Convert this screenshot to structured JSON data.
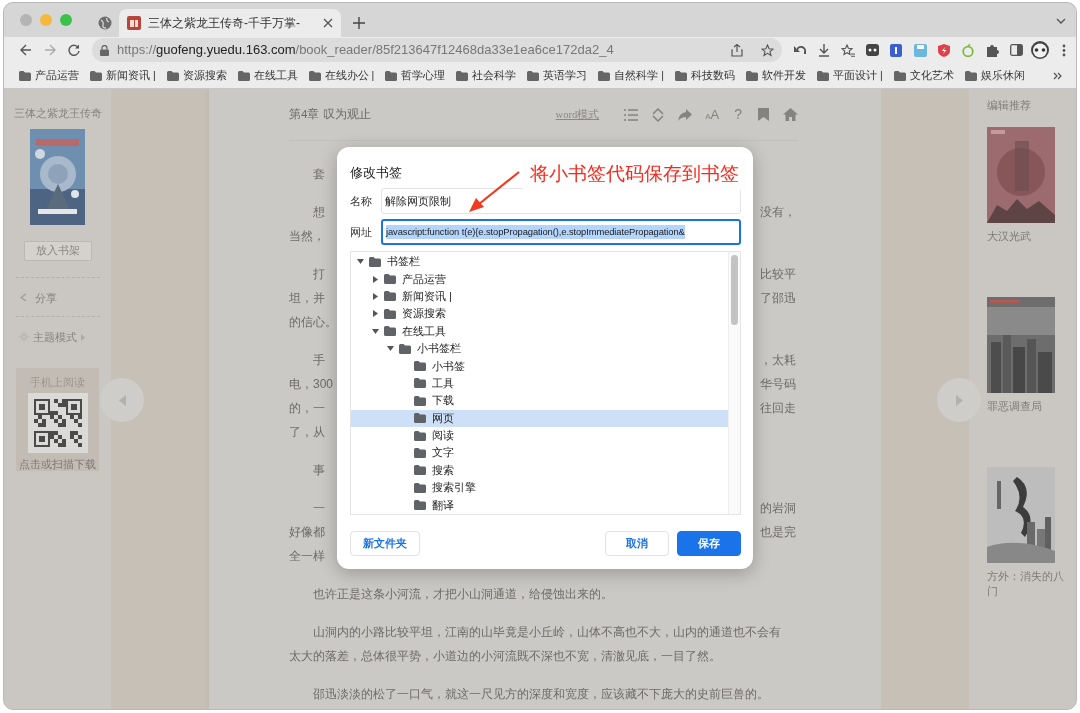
{
  "browser": {
    "tab": {
      "title": "三体之紫龙王传奇-千手万掌-"
    },
    "url": {
      "scheme": "https://",
      "host": "guofeng.yuedu.163.com",
      "path": "/book_reader/85f213647f12468da33e1ea6ce172da2_4"
    },
    "bookmarks": [
      "产品运营",
      "新闻资讯 |",
      "资源搜索",
      "在线工具",
      "在线办公 |",
      "哲学心理",
      "社会科学",
      "英语学习",
      "自然科学 |",
      "科技数码",
      "软件开发",
      "平面设计 |",
      "文化艺术",
      "娱乐休闲"
    ]
  },
  "left_panel": {
    "book_title": "三体之紫龙王传奇",
    "shelf_button": "放入书架",
    "share": "分享",
    "theme_mode": "主题模式",
    "mobile": {
      "title": "手机上阅读",
      "caption": "点击或扫描下载"
    }
  },
  "reader": {
    "chapter": "第4章 叹为观止",
    "mode_link": "word模式",
    "font_glyph": "AA",
    "help_glyph": "?",
    "paragraphs": [
      {
        "lines": [
          {
            "left": "套"
          }
        ]
      },
      {
        "lines": [
          {
            "left": "想",
            "right": "没有，"
          },
          {
            "left": "当然，"
          }
        ]
      },
      {
        "lines": [
          {
            "left": "打",
            "right": "比较平"
          },
          {
            "left": "坦，并",
            "right": "了邵迅"
          },
          {
            "left": "的信心。"
          }
        ]
      },
      {
        "lines": [
          {
            "left": "手",
            "right": "，太耗"
          },
          {
            "left": "电，300",
            "right": "华号码"
          },
          {
            "left": "的，一",
            "right": "往回走"
          },
          {
            "left": "了，从"
          }
        ]
      },
      {
        "lines": [
          {
            "left": "事"
          }
        ]
      },
      {
        "lines": [
          {
            "left": "一",
            "right": "的岩洞"
          },
          {
            "left": "好像都",
            "right": "也是完"
          },
          {
            "left": "全一样"
          }
        ]
      },
      {
        "lines": [
          {
            "left": "也许正是这条小河流，才把小山洞通道，给侵蚀出来的。"
          }
        ]
      },
      {
        "lines": [
          {
            "left": "山洞内的小路比较平坦，江南的山毕竟是小丘岭，山体不高也不大，山内的通道也不会有"
          },
          {
            "left": "太大的落差，总体很平势，小道边的小河流既不深也不宽，清澈见底，一目了然。"
          }
        ]
      },
      {
        "lines": [
          {
            "left": "邵迅淡淡的松了一口气，就这一尺见方的深度和宽度，应该藏不下庞大的史前巨兽的。"
          }
        ]
      }
    ]
  },
  "recommendations": {
    "title": "编辑推荐",
    "books": [
      {
        "title": "大汉光武",
        "kind": "red"
      },
      {
        "title": "罪恶调查局",
        "kind": "city"
      },
      {
        "title": "方外：消失的八门",
        "kind": "ink"
      }
    ]
  },
  "dialog": {
    "title": "修改书签",
    "fields": [
      {
        "label": "名称",
        "value": "解除网页限制",
        "focused": false
      },
      {
        "label": "网址",
        "value": "javascript:function t(e){e.stopPropagation(),e.stopImmediatePropagation&",
        "focused": true
      }
    ],
    "tree": [
      {
        "label": "书签栏",
        "expanded": true,
        "selected": false,
        "children": [
          {
            "label": "产品运营",
            "expanded": false,
            "selected": false
          },
          {
            "label": "新闻资讯 |",
            "expanded": false,
            "selected": false
          },
          {
            "label": "资源搜索",
            "expanded": false,
            "selected": false
          },
          {
            "label": "在线工具",
            "expanded": true,
            "selected": false,
            "children": [
              {
                "label": "小书签栏",
                "expanded": true,
                "selected": false,
                "children": [
                  {
                    "label": "小书签",
                    "selected": false
                  },
                  {
                    "label": "工具",
                    "selected": false
                  },
                  {
                    "label": "下载",
                    "selected": false
                  },
                  {
                    "label": "网页",
                    "selected": true
                  },
                  {
                    "label": "阅读",
                    "selected": false
                  },
                  {
                    "label": "文字",
                    "selected": false
                  },
                  {
                    "label": "搜索",
                    "selected": false
                  },
                  {
                    "label": "搜索引擎",
                    "selected": false
                  },
                  {
                    "label": "翻译",
                    "selected": false
                  }
                ]
              }
            ]
          }
        ]
      }
    ],
    "new_folder": "新文件夹",
    "cancel": "取消",
    "save": "保存"
  },
  "annotation": {
    "text": "将小书签代码保存到书签"
  }
}
